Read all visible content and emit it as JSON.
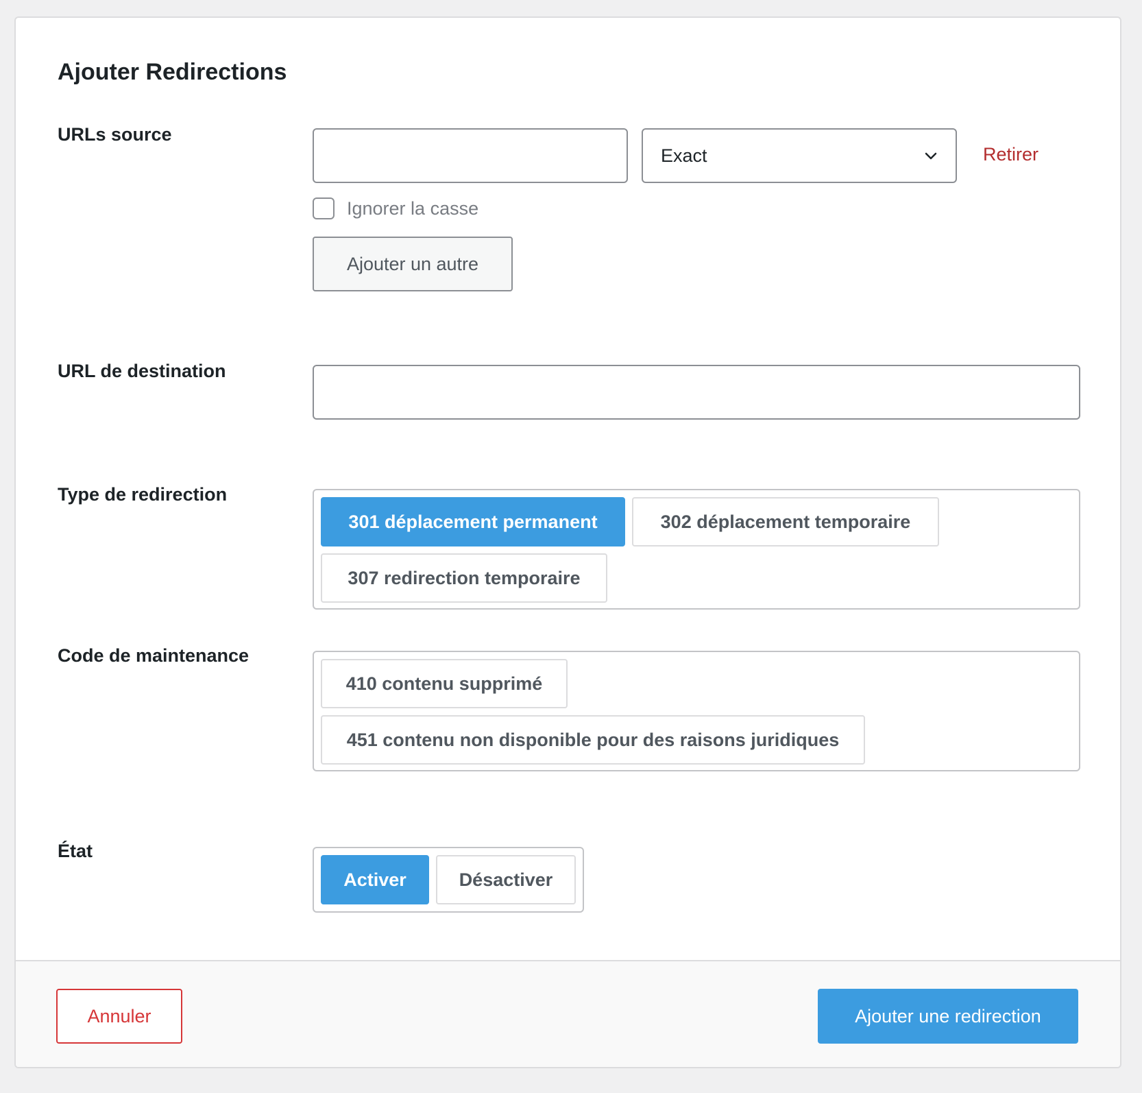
{
  "dialog": {
    "title": "Ajouter Redirections"
  },
  "source_urls": {
    "label": "URLs source",
    "url_value": "",
    "match_type": "Exact",
    "remove_label": "Retirer",
    "ignore_case_label": "Ignorer la casse",
    "ignore_case_checked": false,
    "add_another_label": "Ajouter un autre"
  },
  "destination": {
    "label": "URL de destination",
    "value": ""
  },
  "redirect_type": {
    "label": "Type de redirection",
    "options": [
      {
        "label": "301 déplacement permanent",
        "selected": true
      },
      {
        "label": "302 déplacement temporaire",
        "selected": false
      },
      {
        "label": "307 redirection temporaire",
        "selected": false
      }
    ]
  },
  "maintenance": {
    "label": "Code de maintenance",
    "options": [
      {
        "label": "410 contenu supprimé",
        "selected": false
      },
      {
        "label": "451 contenu non disponible pour des raisons juridiques",
        "selected": false
      }
    ]
  },
  "status": {
    "label": "État",
    "options": [
      {
        "label": "Activer",
        "selected": true
      },
      {
        "label": "Désactiver",
        "selected": false
      }
    ]
  },
  "footer": {
    "cancel_label": "Annuler",
    "submit_label": "Ajouter une redirection"
  },
  "colors": {
    "accent": "#3c9ce0",
    "danger": "#d63638",
    "remove_link": "#b32d2e"
  }
}
